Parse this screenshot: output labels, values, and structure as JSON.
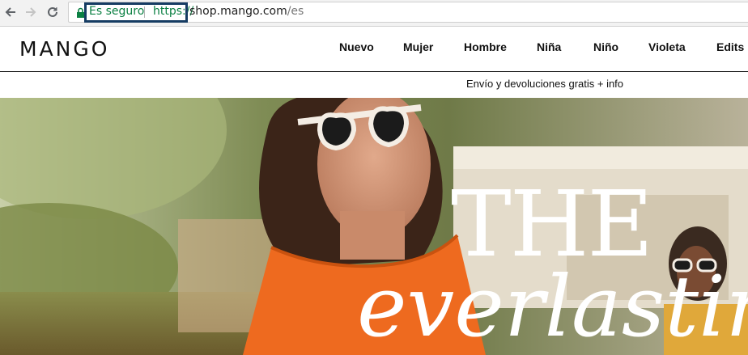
{
  "browser": {
    "security_label": "Es seguro",
    "protocol": "https://",
    "host": "shop.mango.com",
    "path": "/es"
  },
  "site": {
    "logo": "MANGO",
    "nav": [
      "Nuevo",
      "Mujer",
      "Hombre",
      "Niña",
      "Niño",
      "Violeta",
      "Edits"
    ],
    "promo": "Envío y devoluciones gratis + info"
  },
  "hero": {
    "line1": "THE",
    "line2": "everlasting"
  }
}
